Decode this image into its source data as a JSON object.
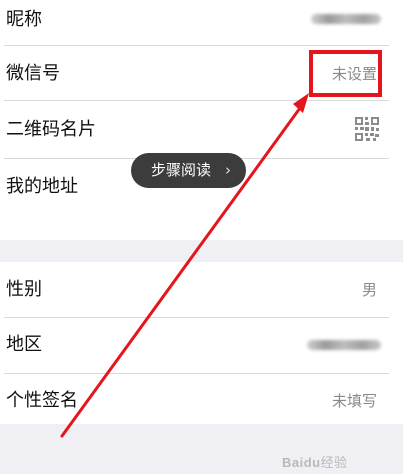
{
  "profile": {
    "nickname": {
      "label": "昵称"
    },
    "wechat_id": {
      "label": "微信号",
      "value": "未设置"
    },
    "qr_card": {
      "label": "二维码名片"
    },
    "address": {
      "label": "我的地址"
    },
    "gender": {
      "label": "性别",
      "value": "男"
    },
    "region": {
      "label": "地区"
    },
    "signature": {
      "label": "个性签名",
      "value": "未填写"
    }
  },
  "overlay": {
    "step_read": "步骤阅读",
    "chevron": "›"
  },
  "watermark": {
    "brand": "Baidu",
    "suffix": "经验"
  },
  "colors": {
    "highlight": "#e4151c",
    "background": "#efeff4"
  }
}
